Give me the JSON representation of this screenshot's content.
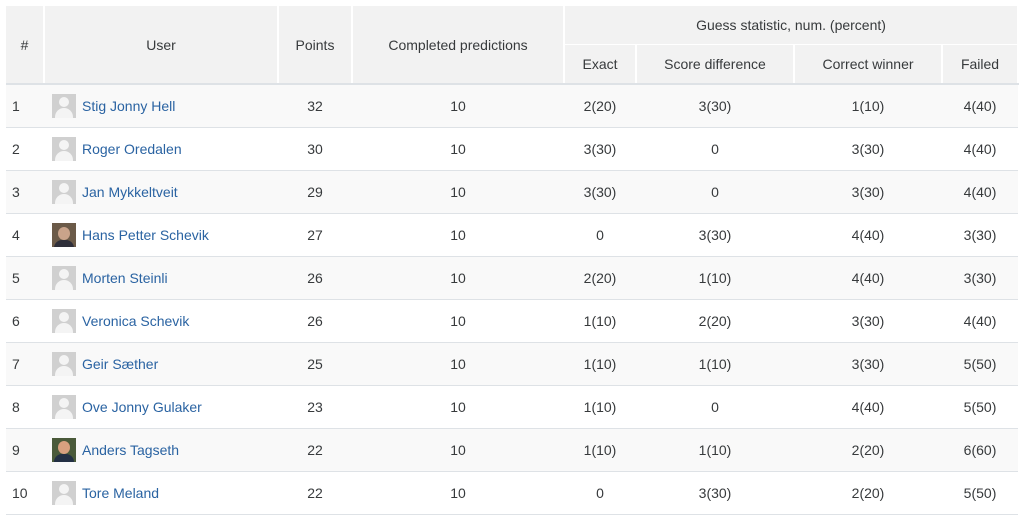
{
  "table": {
    "headers": {
      "rank": "#",
      "user": "User",
      "points": "Points",
      "completed": "Completed predictions",
      "guess_group": "Guess statistic, num. (percent)",
      "exact": "Exact",
      "score_diff": "Score difference",
      "correct_winner": "Correct winner",
      "failed": "Failed"
    },
    "rows": [
      {
        "rank": "1",
        "name": "Stig Jonny Hell",
        "avatar": "default-avatar-icon",
        "points": "32",
        "completed": "10",
        "exact": "2(20)",
        "score_diff": "3(30)",
        "correct_winner": "1(10)",
        "failed": "4(40)"
      },
      {
        "rank": "2",
        "name": "Roger Oredalen",
        "avatar": "default-avatar-icon",
        "points": "30",
        "completed": "10",
        "exact": "3(30)",
        "score_diff": "0",
        "correct_winner": "3(30)",
        "failed": "4(40)"
      },
      {
        "rank": "3",
        "name": "Jan Mykkeltveit",
        "avatar": "default-avatar-icon",
        "points": "29",
        "completed": "10",
        "exact": "3(30)",
        "score_diff": "0",
        "correct_winner": "3(30)",
        "failed": "4(40)"
      },
      {
        "rank": "4",
        "name": "Hans Petter Schevik",
        "avatar": "photo-avatar",
        "points": "27",
        "completed": "10",
        "exact": "0",
        "score_diff": "3(30)",
        "correct_winner": "4(40)",
        "failed": "3(30)"
      },
      {
        "rank": "5",
        "name": "Morten Steinli",
        "avatar": "default-avatar-icon",
        "points": "26",
        "completed": "10",
        "exact": "2(20)",
        "score_diff": "1(10)",
        "correct_winner": "4(40)",
        "failed": "3(30)"
      },
      {
        "rank": "6",
        "name": "Veronica Schevik",
        "avatar": "default-avatar-icon",
        "points": "26",
        "completed": "10",
        "exact": "1(10)",
        "score_diff": "2(20)",
        "correct_winner": "3(30)",
        "failed": "4(40)"
      },
      {
        "rank": "7",
        "name": "Geir Sæther",
        "avatar": "default-avatar-icon",
        "points": "25",
        "completed": "10",
        "exact": "1(10)",
        "score_diff": "1(10)",
        "correct_winner": "3(30)",
        "failed": "5(50)"
      },
      {
        "rank": "8",
        "name": "Ove Jonny Gulaker",
        "avatar": "default-avatar-icon",
        "points": "23",
        "completed": "10",
        "exact": "1(10)",
        "score_diff": "0",
        "correct_winner": "4(40)",
        "failed": "5(50)"
      },
      {
        "rank": "9",
        "name": "Anders Tagseth",
        "avatar": "photo-avatar",
        "points": "22",
        "completed": "10",
        "exact": "1(10)",
        "score_diff": "1(10)",
        "correct_winner": "2(20)",
        "failed": "6(60)"
      },
      {
        "rank": "10",
        "name": "Tore Meland",
        "avatar": "default-avatar-icon",
        "points": "22",
        "completed": "10",
        "exact": "0",
        "score_diff": "3(30)",
        "correct_winner": "2(20)",
        "failed": "5(50)"
      }
    ]
  },
  "colors": {
    "link": "#2a63a2",
    "header_bg": "#f2f2f2",
    "stripe_bg": "#f9f9f9",
    "border": "#dee2e6"
  }
}
